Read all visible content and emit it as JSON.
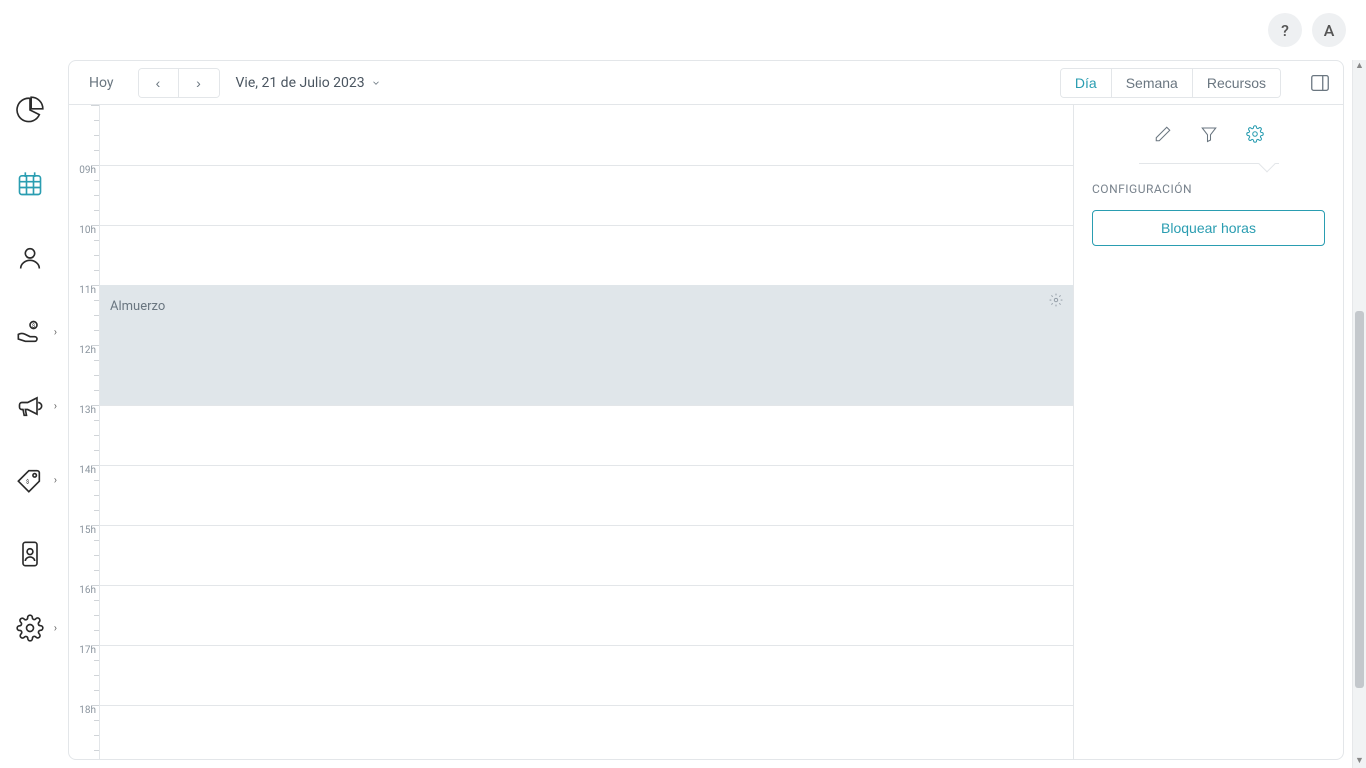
{
  "topbar": {
    "help": "?",
    "avatar": "A"
  },
  "sidebar": {
    "items": [
      {
        "name": "dashboard",
        "icon": "pie",
        "active": false,
        "has_menu": false
      },
      {
        "name": "calendar",
        "icon": "calendar",
        "active": true,
        "has_menu": false
      },
      {
        "name": "clients",
        "icon": "person",
        "active": false,
        "has_menu": false
      },
      {
        "name": "payments",
        "icon": "hand-coin",
        "active": false,
        "has_menu": true
      },
      {
        "name": "marketing",
        "icon": "megaphone",
        "active": false,
        "has_menu": true
      },
      {
        "name": "pricing",
        "icon": "tag",
        "active": false,
        "has_menu": true
      },
      {
        "name": "staff",
        "icon": "badge",
        "active": false,
        "has_menu": false
      },
      {
        "name": "settings",
        "icon": "gear",
        "active": false,
        "has_menu": true
      }
    ]
  },
  "toolbar": {
    "today": "Hoy",
    "date": "Vie, 21 de Julio 2023",
    "views": {
      "day": "Día",
      "week": "Semana",
      "resources": "Recursos"
    },
    "active_view": "day"
  },
  "calendar": {
    "hours": [
      "",
      "09h",
      "10h",
      "11h",
      "12h",
      "13h",
      "14h",
      "15h",
      "16h",
      "17h",
      "18h"
    ],
    "events": [
      {
        "title": "Almuerzo",
        "start_index": 3,
        "span_hours": 2
      }
    ]
  },
  "panel": {
    "title": "CONFIGURACIÓN",
    "block_hours": "Bloquear horas"
  }
}
